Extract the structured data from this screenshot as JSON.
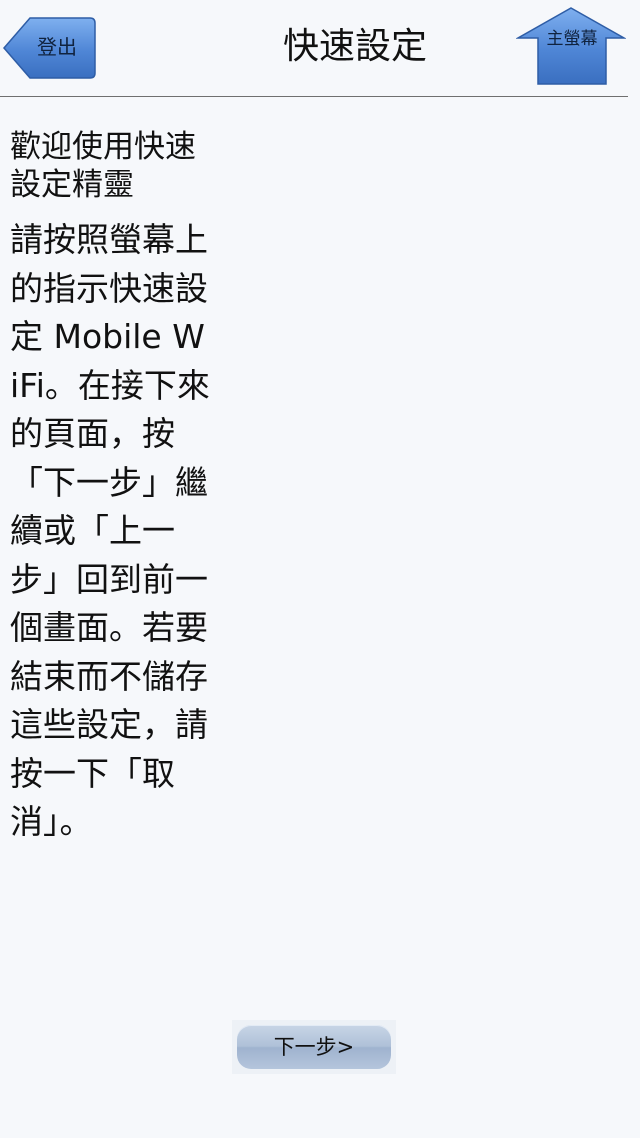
{
  "header": {
    "logout_label": "登出",
    "title": "快速設定",
    "home_label": "主螢幕"
  },
  "content": {
    "welcome": "歡迎使用快速設定精靈",
    "instructions": "請按照螢幕上的指示快速設定 Mobile WiFi。在接下來的頁面，按「下一步」繼續或「上一步」回到前一個畫面。若要結束而不儲存這些設定，請按一下「取消」。"
  },
  "footer": {
    "next_label": "下一步>"
  },
  "colors": {
    "background": "#f6f8fb",
    "button_blue": "#4f86d6",
    "header_rule": "#6f6f6f"
  }
}
